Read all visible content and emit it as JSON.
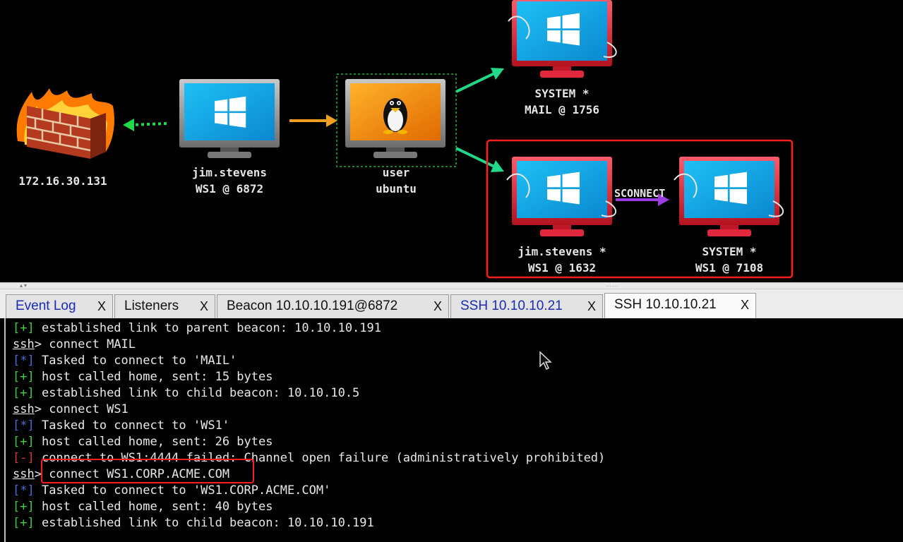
{
  "graph": {
    "firewall": {
      "label": "172.16.30.131"
    },
    "beacon_jim": {
      "line1": "jim.stevens",
      "line2": "WS1 @ 6872"
    },
    "ssh_user": {
      "line1": "user",
      "line2": "ubuntu"
    },
    "mail": {
      "line1": "SYSTEM *",
      "line2": "MAIL @ 1756"
    },
    "ws1_jim": {
      "line1": "jim.stevens *",
      "line2": "WS1 @ 1632"
    },
    "ws1_system": {
      "line1": "SYSTEM *",
      "line2": "WS1 @ 7108"
    },
    "edge_label": "SCONNECT"
  },
  "tabs": [
    {
      "label": "Event Log",
      "close": "X",
      "active": false,
      "blue": true
    },
    {
      "label": "Listeners",
      "close": "X",
      "active": false,
      "blue": false
    },
    {
      "label": "Beacon 10.10.10.191@6872",
      "close": "X",
      "active": false,
      "blue": false
    },
    {
      "label": "SSH 10.10.10.21",
      "close": "X",
      "active": false,
      "blue": true
    },
    {
      "label": "SSH 10.10.10.21",
      "close": "X",
      "active": true,
      "blue": false
    }
  ],
  "console": {
    "lines": [
      {
        "tag": "[+]",
        "kind": "ok",
        "text": " established link to parent beacon: 10.10.10.191"
      },
      {
        "prompt": "ssh",
        "text": "> connect MAIL"
      },
      {
        "tag": "[*]",
        "kind": "info",
        "text": " Tasked to connect to 'MAIL'"
      },
      {
        "tag": "[+]",
        "kind": "ok",
        "text": " host called home, sent: 15 bytes"
      },
      {
        "tag": "[+]",
        "kind": "ok",
        "text": " established link to child beacon: 10.10.10.5"
      },
      {
        "prompt": "ssh",
        "text": "> connect WS1"
      },
      {
        "tag": "[*]",
        "kind": "info",
        "text": " Tasked to connect to 'WS1'"
      },
      {
        "tag": "[+]",
        "kind": "ok",
        "text": " host called home, sent: 26 bytes"
      },
      {
        "tag": "[-]",
        "kind": "err",
        "text": " connect to WS1:4444 failed: Channel open failure (administratively prohibited)"
      },
      {
        "prompt": "ssh",
        "text": "> connect WS1.CORP.ACME.COM"
      },
      {
        "tag": "[*]",
        "kind": "info",
        "text": " Tasked to connect to 'WS1.CORP.ACME.COM'"
      },
      {
        "tag": "[+]",
        "kind": "ok",
        "text": " host called home, sent: 40 bytes"
      },
      {
        "tag": "[+]",
        "kind": "ok",
        "text": " established link to child beacon: 10.10.10.191"
      }
    ]
  },
  "colors": {
    "highlight": "#ff1e1e",
    "edge_green": "#22d98a",
    "edge_orange": "#f0a020",
    "edge_purple": "#9b3be0",
    "monitor_red": "#e0283c",
    "screen_blue": "#1aa6e8"
  },
  "icons": [
    "firewall-icon",
    "windows-monitor-icon",
    "linux-tux-icon",
    "mouse-pointer-icon"
  ]
}
